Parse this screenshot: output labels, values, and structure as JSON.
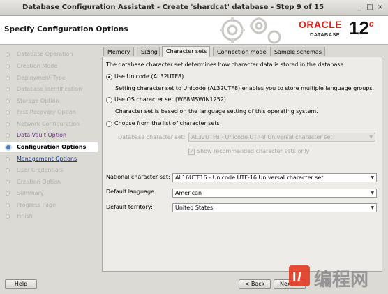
{
  "window": {
    "title": "Database Configuration Assistant - Create 'shardcat' database - Step 9 of 15",
    "controls": [
      "_",
      "□",
      "×"
    ]
  },
  "header": {
    "page_title": "Specify Configuration Options",
    "logo_oracle": "ORACLE",
    "logo_database": "DATABASE",
    "logo_version": "12",
    "logo_version_suffix": "c"
  },
  "steps": [
    {
      "label": "Database Operation",
      "state": "done"
    },
    {
      "label": "Creation Mode",
      "state": "done"
    },
    {
      "label": "Deployment Type",
      "state": "done"
    },
    {
      "label": "Database Identification",
      "state": "done"
    },
    {
      "label": "Storage Option",
      "state": "done"
    },
    {
      "label": "Fast Recovery Option",
      "state": "done"
    },
    {
      "label": "Network Configuration",
      "state": "done"
    },
    {
      "label": "Data Vault Option",
      "state": "link"
    },
    {
      "label": "Configuration Options",
      "state": "current"
    },
    {
      "label": "Management Options",
      "state": "link"
    },
    {
      "label": "User Credentials",
      "state": "pending"
    },
    {
      "label": "Creation Option",
      "state": "pending"
    },
    {
      "label": "Summary",
      "state": "pending"
    },
    {
      "label": "Progress Page",
      "state": "pending"
    },
    {
      "label": "Finish",
      "state": "pending"
    }
  ],
  "tabs": [
    {
      "label": "Memory",
      "active": false
    },
    {
      "label": "Sizing",
      "active": false
    },
    {
      "label": "Character sets",
      "active": true
    },
    {
      "label": "Connection mode",
      "active": false
    },
    {
      "label": "Sample schemas",
      "active": false
    }
  ],
  "charset": {
    "intro": "The database character set determines how character data is stored in the database.",
    "unicode_label": "Use Unicode (AL32UTF8)",
    "unicode_desc": "Setting character set to Unicode (AL32UTF8) enables you to store multiple language groups.",
    "os_label": "Use OS character set (WE8MSWIN1252)",
    "os_desc": "Character set is based on the language setting of this operating system.",
    "list_label": "Choose from the list of character sets",
    "db_charset_label": "Database character set:",
    "db_charset_value": "AL32UTF8 - Unicode UTF-8 Universal character set",
    "show_recommended_label": "Show recommended character sets only",
    "show_recommended_checked": true,
    "selected": "unicode"
  },
  "national": {
    "label": "National character set:",
    "value": "AL16UTF16 - Unicode UTF-16 Universal character set"
  },
  "language": {
    "label": "Default language:",
    "value": "American"
  },
  "territory": {
    "label": "Default territory:",
    "value": "United States"
  },
  "buttons": {
    "help": "Help",
    "back": "< Back",
    "next": "Next >"
  },
  "watermark": {
    "text": "编程网"
  },
  "colors": {
    "oracle_red": "#e2231a",
    "current_step_bg": "#ffffff",
    "panel_bg": "#eeece8"
  }
}
